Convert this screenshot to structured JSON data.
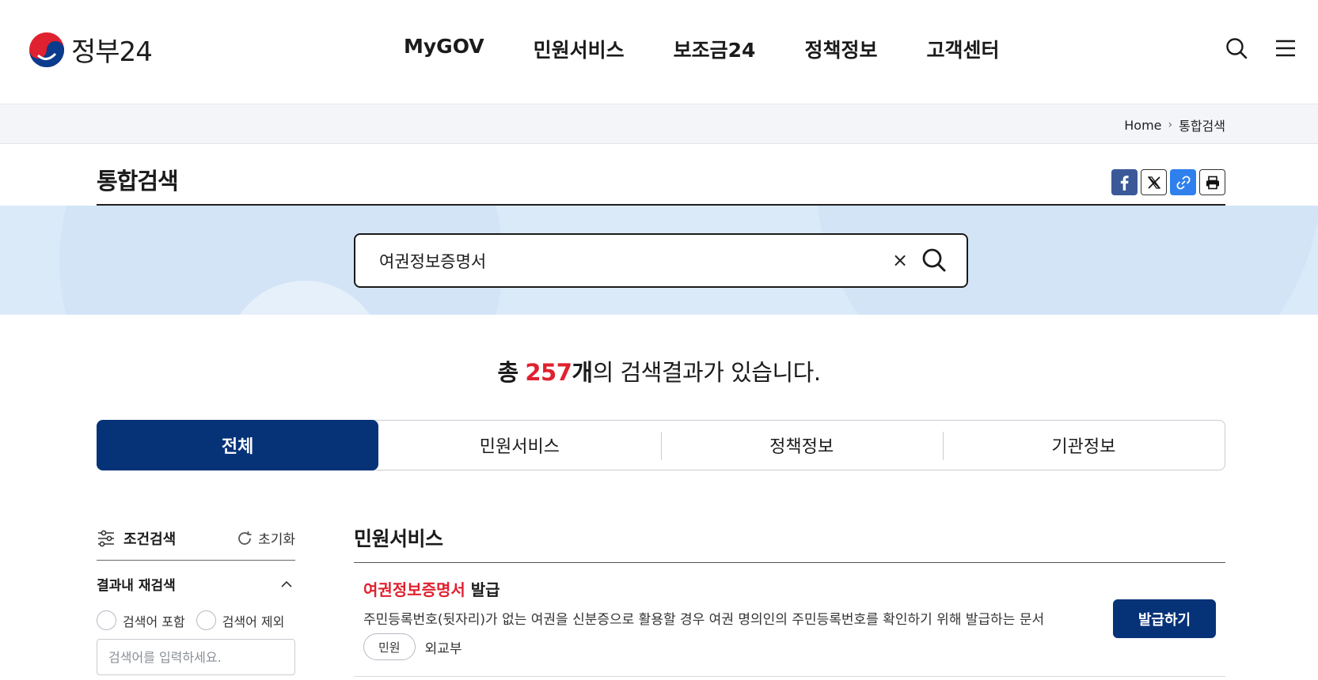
{
  "header": {
    "logo_text": "정부24",
    "nav": [
      "MyGOV",
      "민원서비스",
      "보조금24",
      "정책정보",
      "고객센터"
    ]
  },
  "breadcrumb": {
    "home": "Home",
    "current": "통합검색"
  },
  "page": {
    "title": "통합검색"
  },
  "search": {
    "query": "여권정보증명서"
  },
  "summary": {
    "prefix": "총",
    "count": "257",
    "unit": "개",
    "suffix": "의 검색결과가 있습니다."
  },
  "tabs": [
    {
      "label": "전체",
      "active": true
    },
    {
      "label": "민원서비스",
      "active": false
    },
    {
      "label": "정책정보",
      "active": false
    },
    {
      "label": "기관정보",
      "active": false
    }
  ],
  "filter": {
    "title": "조건검색",
    "reset_label": "초기화",
    "refine_title": "결과내 재검색",
    "option_include": "검색어 포함",
    "option_exclude": "검색어 제외",
    "input_placeholder": "검색어를 입력하세요."
  },
  "results": {
    "section_title": "민원서비스",
    "items": [
      {
        "title_highlight": "여권정보증명서",
        "title_rest": " 발급",
        "description": "주민등록번호(뒷자리)가 없는 여권을 신분증으로 활용할 경우 여권 명의인의 주민등록번호를 확인하기 위해 발급하는 문서",
        "tag": "민원",
        "org": "외교부",
        "action_label": "발급하기"
      }
    ]
  },
  "colors": {
    "primary_navy": "#063278",
    "highlight_red": "#e0212f",
    "search_band": "#dbeaf9"
  }
}
